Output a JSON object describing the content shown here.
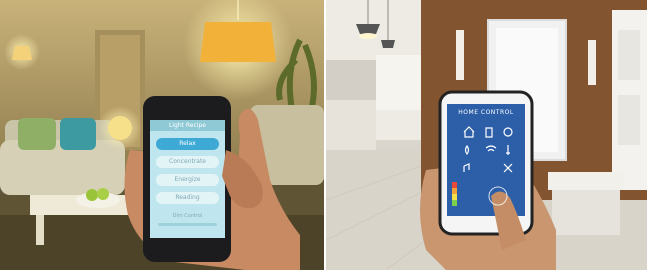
{
  "left_phone": {
    "header": "Light Recipe",
    "items": [
      "Relax",
      "Concentrate",
      "Energize",
      "Reading"
    ],
    "footer": "Dim Control"
  },
  "right_phone": {
    "header": "HOME CONTROL"
  },
  "colors": {
    "lamp_shade": "#f2b23a",
    "left_screen": "#bfe6ee",
    "left_highlight": "#3fa9d6",
    "right_screen": "#2c5fa8",
    "wood_wall": "#8a5a34"
  },
  "icons": [
    "home-icon",
    "bulb-icon",
    "lock-icon",
    "music-icon",
    "thermometer-icon",
    "tools-icon",
    "drop-icon",
    "wifi-icon"
  ]
}
